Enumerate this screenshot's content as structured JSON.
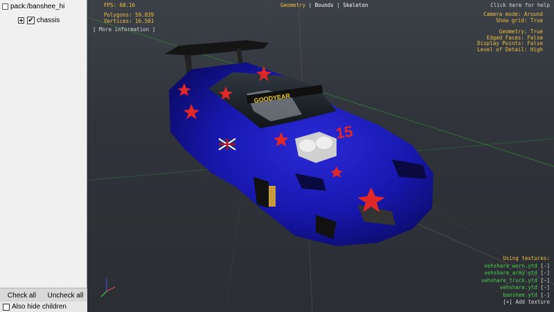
{
  "tree": {
    "root_label": "pack:/banshee_hi",
    "child_label": "chassis",
    "child_checked": "✔"
  },
  "panel_buttons": {
    "check_all": "Check all",
    "uncheck_all": "Uncheck all",
    "also_hide_children": "Also hide children"
  },
  "stats": {
    "fps": "FPS: 60.16",
    "polygons": "Polygons: 59.839",
    "vertices": "Vertices: 16.501",
    "more_info": "[ More information ]"
  },
  "view_tabs": {
    "geometry": "Geometry",
    "sep1": "|",
    "bounds": "Bounds",
    "sep2": "|",
    "skeleton": "Skeleton"
  },
  "help": "Click here for help",
  "settings": [
    "Camera mode: Around",
    "Show grid: True",
    "",
    "Geometry: True",
    "Edged Faces: False",
    "Display Points: False",
    "Level of Detail: High"
  ],
  "textures": {
    "heading": "Using textures:",
    "items": [
      {
        "name": "vehshare_worn.ytd",
        "btn": "[-]"
      },
      {
        "name": "vehshare_army.ytd",
        "btn": "[-]"
      },
      {
        "name": "vehshare_truck.ytd",
        "btn": "[-]"
      },
      {
        "name": "vehshare.ytd",
        "btn": "[-]"
      },
      {
        "name": "banshee.ytd",
        "btn": "[-]"
      }
    ],
    "add": "[+] Add texture"
  },
  "car": {
    "number": "15",
    "brand": "GOODYEAR"
  },
  "colors": {
    "accent": "#f0c040",
    "texture_green": "#4ad04a",
    "car_blue": "#1a1ab8",
    "star_red": "#e02828"
  }
}
